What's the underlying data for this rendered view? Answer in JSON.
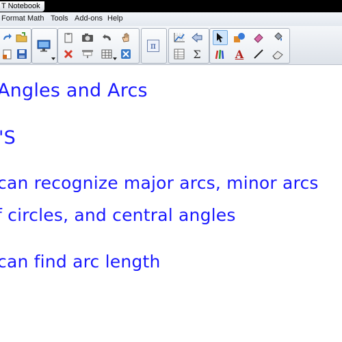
{
  "window": {
    "title": "T Notebook"
  },
  "menu": {
    "items": [
      "Format",
      "Math",
      "Tools",
      "Add-ons",
      "Help"
    ]
  },
  "toolbar": {
    "math_label": "π",
    "sigma_label": "Σ",
    "text_label": "A"
  },
  "canvas": {
    "ink_color": "#1a1aff",
    "lines": [
      "Angles and Arcs",
      "'S",
      "can recognize major arcs, minor arcs",
      "f circles, and central angles",
      "can find arc length"
    ]
  }
}
